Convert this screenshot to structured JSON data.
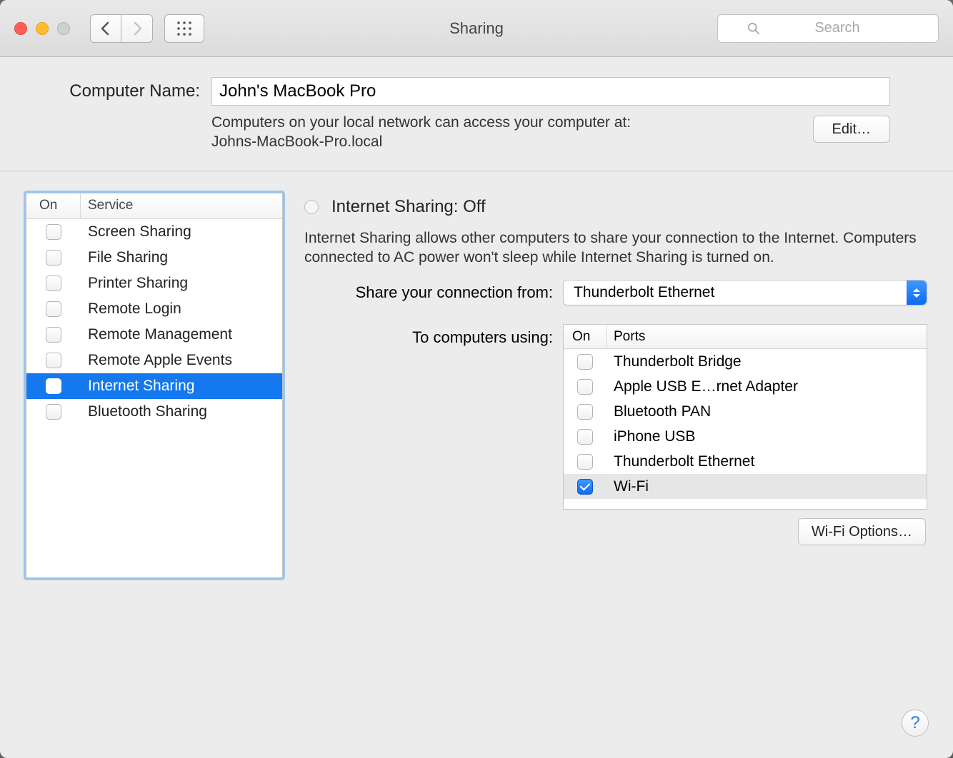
{
  "window_title": "Sharing",
  "search_placeholder": "Search",
  "computer_name": {
    "label": "Computer Name:",
    "value": "John's MacBook Pro",
    "help_line1": "Computers on your local network can access your computer at:",
    "help_line2": "Johns-MacBook-Pro.local",
    "edit_label": "Edit…"
  },
  "services": {
    "col_on": "On",
    "col_service": "Service",
    "items": [
      {
        "label": "Screen Sharing",
        "checked": false,
        "selected": false
      },
      {
        "label": "File Sharing",
        "checked": false,
        "selected": false
      },
      {
        "label": "Printer Sharing",
        "checked": false,
        "selected": false
      },
      {
        "label": "Remote Login",
        "checked": false,
        "selected": false
      },
      {
        "label": "Remote Management",
        "checked": false,
        "selected": false
      },
      {
        "label": "Remote Apple Events",
        "checked": false,
        "selected": false
      },
      {
        "label": "Internet Sharing",
        "checked": false,
        "selected": true
      },
      {
        "label": "Bluetooth Sharing",
        "checked": false,
        "selected": false
      }
    ]
  },
  "detail": {
    "title": "Internet Sharing: Off",
    "description": "Internet Sharing allows other computers to share your connection to the Internet. Computers connected to AC power won't sleep while Internet Sharing is turned on.",
    "share_from_label": "Share your connection from:",
    "share_from_selected": "Thunderbolt Ethernet",
    "to_label": "To computers using:",
    "ports_col_on": "On",
    "ports_col_ports": "Ports",
    "ports": [
      {
        "label": "Thunderbolt Bridge",
        "checked": false,
        "selected": false
      },
      {
        "label": "Apple USB E…rnet Adapter",
        "checked": false,
        "selected": false
      },
      {
        "label": "Bluetooth PAN",
        "checked": false,
        "selected": false
      },
      {
        "label": "iPhone USB",
        "checked": false,
        "selected": false
      },
      {
        "label": "Thunderbolt Ethernet",
        "checked": false,
        "selected": false
      },
      {
        "label": "Wi-Fi",
        "checked": true,
        "selected": true
      }
    ],
    "wifi_options_label": "Wi-Fi Options…"
  },
  "help_label": "?"
}
